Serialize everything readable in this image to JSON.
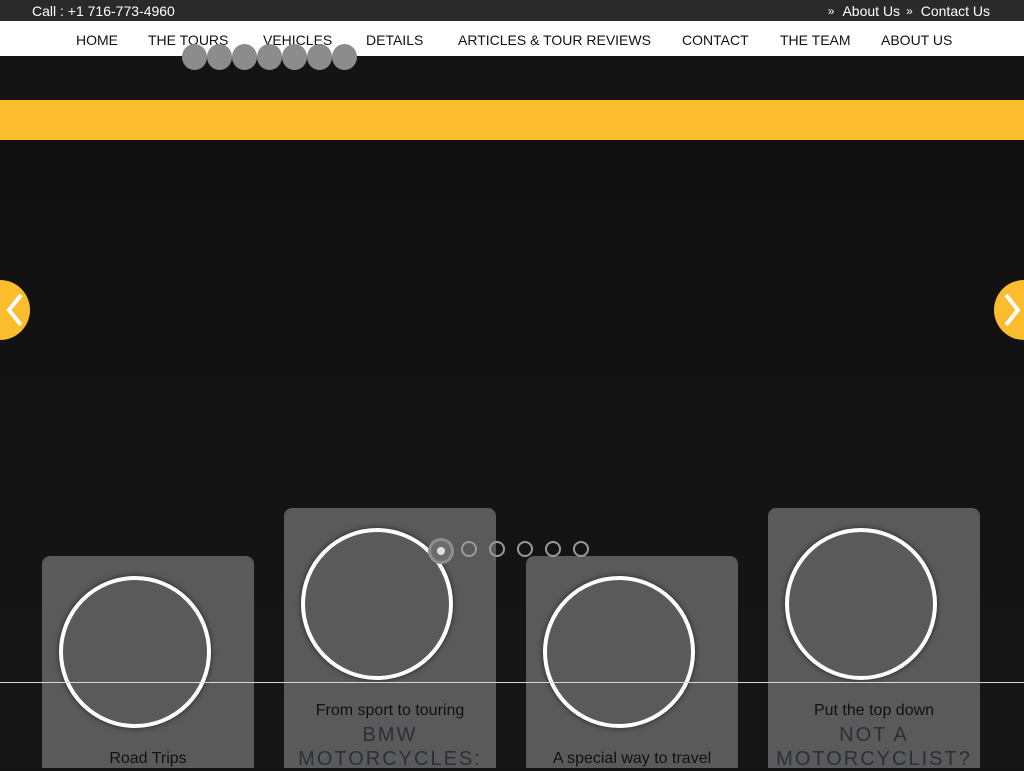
{
  "topbar": {
    "call_label": "Call  :",
    "phone": "+1 716-773-4960",
    "links": [
      {
        "label": "About Us"
      },
      {
        "label": "Contact Us"
      }
    ]
  },
  "nav": {
    "items": [
      {
        "label": "HOME"
      },
      {
        "label": "THE TOURS"
      },
      {
        "label": "VEHICLES"
      },
      {
        "label": "DETAILS"
      },
      {
        "label": "ARTICLES & TOUR REVIEWS"
      },
      {
        "label": "CONTACT"
      },
      {
        "label": "THE TEAM"
      },
      {
        "label": "ABOUT US"
      }
    ]
  },
  "slider": {
    "dot_count": 6,
    "active_dot": 1,
    "prev_icon": "chevron-left-icon",
    "next_icon": "chevron-right-icon"
  },
  "cards": [
    {
      "caption": "Road Trips",
      "heading": ""
    },
    {
      "caption": "From sport to touring",
      "heading": "BMW MOTORCYCLES:"
    },
    {
      "caption": "A special way to travel",
      "heading": ""
    },
    {
      "caption": "Put the top down",
      "heading": "NOT A MOTORCYCLIST?"
    }
  ],
  "colors": {
    "accent": "#fbbc2e",
    "background": "#141414",
    "card": "#5a5a5a"
  }
}
